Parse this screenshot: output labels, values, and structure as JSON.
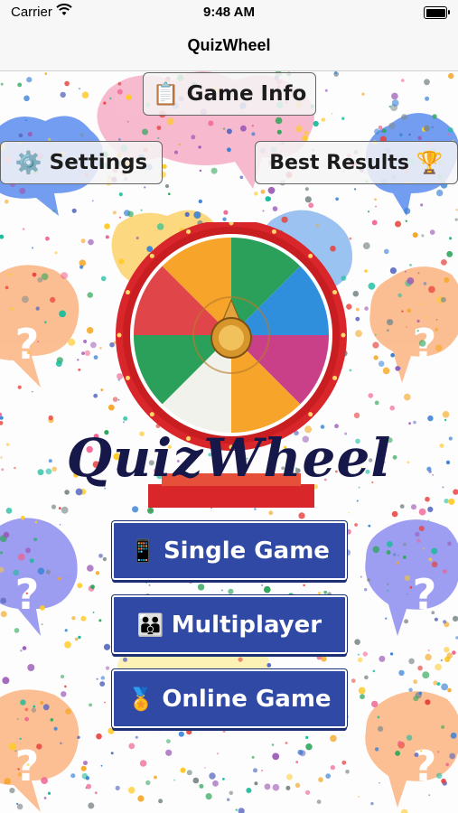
{
  "status_bar": {
    "carrier": "Carrier",
    "time": "9:48 AM"
  },
  "nav": {
    "title": "QuizWheel"
  },
  "buttons": {
    "game_info": {
      "icon": "clipboard-icon",
      "emoji": "📋",
      "label": "Game Info"
    },
    "settings": {
      "icon": "gear-icon",
      "emoji": "⚙️",
      "label": "Settings"
    },
    "best_results": {
      "icon": "trophy-icon",
      "emoji": "🏆",
      "label": "Best Results"
    },
    "single_game": {
      "icon": "phone-icon",
      "emoji": "📱",
      "label": "Single Game"
    },
    "multiplayer": {
      "icon": "family-icon",
      "emoji": "👪",
      "label": "Multiplayer"
    },
    "online_game": {
      "icon": "medal-icon",
      "emoji": "🏅",
      "label": "Online Game"
    }
  },
  "logo": {
    "text": "QuizWheel"
  },
  "colors": {
    "button_blue": "#2f49a4",
    "wheel_rim": "#d9262b",
    "wheel_segments": [
      "#f7a42a",
      "#2aa05a",
      "#2f8fdd",
      "#c94088",
      "#f7a42a",
      "#f2f2ec",
      "#2aa05a",
      "#e0454a"
    ]
  }
}
